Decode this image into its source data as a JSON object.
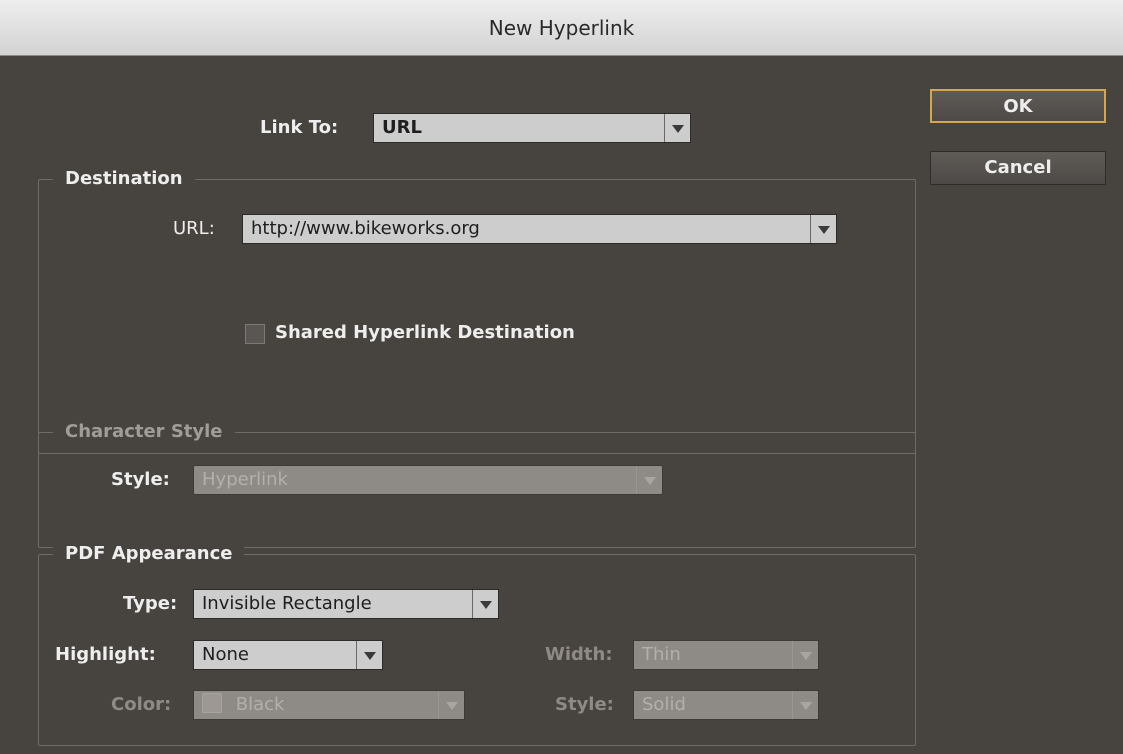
{
  "window": {
    "title": "New Hyperlink"
  },
  "link_to": {
    "label": "Link To:",
    "value": "URL"
  },
  "destination": {
    "legend": "Destination",
    "url_label": "URL:",
    "url_value": "http://www.bikeworks.org",
    "shared_label": "Shared Hyperlink Destination",
    "shared_checked": false
  },
  "character_style": {
    "legend": "Character Style",
    "style_label": "Style:",
    "style_value": "Hyperlink",
    "enabled": false
  },
  "pdf_appearance": {
    "legend": "PDF Appearance",
    "type_label": "Type:",
    "type_value": "Invisible Rectangle",
    "highlight_label": "Highlight:",
    "highlight_value": "None",
    "width_label": "Width:",
    "width_value": "Thin",
    "color_label": "Color:",
    "color_value": "Black",
    "style_label": "Style:",
    "style_value": "Solid"
  },
  "buttons": {
    "ok": "OK",
    "cancel": "Cancel"
  },
  "colors": {
    "dialog_bg": "#47433f",
    "default_button_border": "#d7a54a"
  }
}
